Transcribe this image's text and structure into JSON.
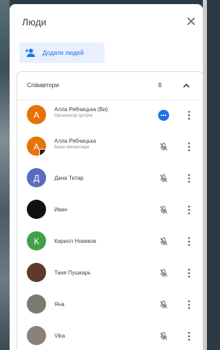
{
  "panel": {
    "title": "Люди",
    "add_people_label": "Додати людей"
  },
  "section": {
    "title": "Співавтори",
    "count": "8"
  },
  "participants": [
    {
      "name": "Алла Рябчицька (Ви)",
      "subtitle": "Організатор зустрічі",
      "initial": "А",
      "color": "#e8710a",
      "status": "speaking",
      "presenting_badge": false
    },
    {
      "name": "Алла Рябчицька",
      "subtitle": "Ваша презентація",
      "initial": "А",
      "color": "#e8710a",
      "status": "muted-presenting",
      "presenting_badge": true
    },
    {
      "name": "Дана Титар",
      "subtitle": "",
      "initial": "Д",
      "color": "#5c6bc0",
      "status": "muted",
      "presenting_badge": false
    },
    {
      "name": "Иван",
      "subtitle": "",
      "initial": "",
      "color": "#111111",
      "status": "muted",
      "presenting_badge": false
    },
    {
      "name": "Кирилл Новиков",
      "subtitle": "",
      "initial": "К",
      "color": "#43a047",
      "status": "muted",
      "presenting_badge": false
    },
    {
      "name": "Таня Пушкарь",
      "subtitle": "",
      "initial": "",
      "color": "#5d3a2a",
      "status": "muted",
      "presenting_badge": false
    },
    {
      "name": "Яна",
      "subtitle": "",
      "initial": "",
      "color": "#7a7a6e",
      "status": "muted",
      "presenting_badge": false
    },
    {
      "name": "Vika",
      "subtitle": "",
      "initial": "",
      "color": "#8a8276",
      "status": "muted",
      "presenting_badge": false
    }
  ],
  "colors": {
    "accent": "#1a73e8",
    "accent_bg": "#e8f0fe"
  },
  "icons": {
    "close": "close-icon",
    "add_person": "person-add-icon",
    "collapse": "chevron-up-icon",
    "speaking": "audio-level-icon",
    "muted": "mic-off-icon",
    "more": "more-vert-icon"
  }
}
